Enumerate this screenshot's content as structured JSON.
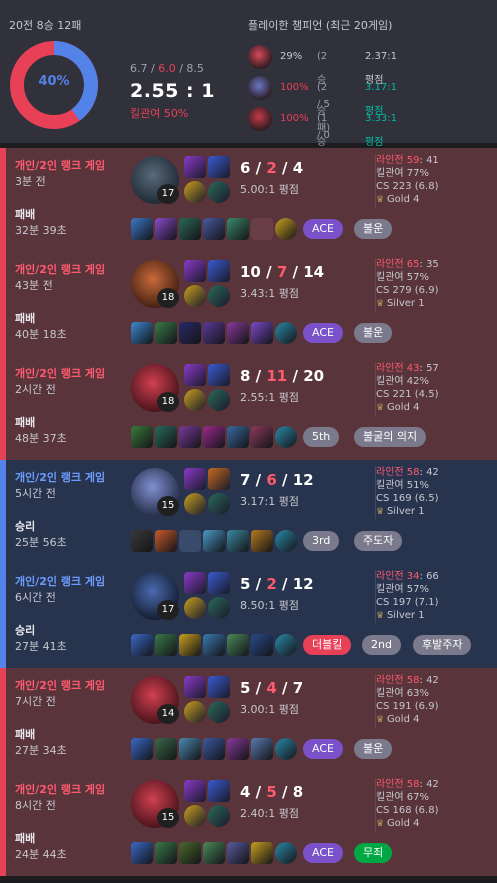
{
  "summary": {
    "record": "20전 8승 12패",
    "winrate_label": "40%",
    "winrate_fraction": 0.4,
    "kda_line": "6.7 / 6.0 / 8.5",
    "kda_k": "6.7",
    "kda_d": "6.0",
    "kda_a": "8.5",
    "ratio": "2.55 : 1",
    "kill_participation": "킬관여 50%",
    "colors": {
      "win": "#5383e8",
      "loss": "#e84057"
    }
  },
  "recent": {
    "heading": "플레이한 챔피언 (최근 20게임)",
    "champions": [
      {
        "icon": "champion-portrait-red",
        "winrate": "29%",
        "record": "(2승 / 5패)",
        "ratio": "2.37:1 평점"
      },
      {
        "icon": "champion-portrait-blue",
        "winrate": "100%",
        "record": "(2승 / 0패)",
        "ratio": "3.17:1 평점"
      },
      {
        "icon": "champion-portrait-red",
        "winrate": "100%",
        "record": "(1승 / 0패)",
        "ratio": "3.33:1 평점"
      }
    ]
  },
  "matches": [
    {
      "result": "loss",
      "mode": "개인/2인 랭크 게임",
      "ago": "3분 전",
      "result_label": "패배",
      "duration": "32분 39초",
      "level": "17",
      "k": "6",
      "d": "2",
      "a": "4",
      "ratio": "5.00:1 평점",
      "lane": "라인전 59",
      "lane_score": ": 41",
      "kp": "킬관여 77%",
      "cs": "CS 223 (6.8)",
      "tier": "Gold 4",
      "badges": [
        {
          "text": "ACE",
          "color": "#7b51c9"
        },
        {
          "text": "불운",
          "color": "#7a7a8c"
        }
      ]
    },
    {
      "result": "loss",
      "mode": "개인/2인 랭크 게임",
      "ago": "43분 전",
      "result_label": "패배",
      "duration": "40분 18초",
      "level": "18",
      "k": "10",
      "d": "7",
      "a": "14",
      "ratio": "3.43:1 평점",
      "lane": "라인전 65",
      "lane_score": ": 35",
      "kp": "킬관여 57%",
      "cs": "CS 279 (6.9)",
      "tier": "Silver 1",
      "badges": [
        {
          "text": "ACE",
          "color": "#7b51c9"
        },
        {
          "text": "불운",
          "color": "#7a7a8c"
        }
      ]
    },
    {
      "result": "loss",
      "mode": "개인/2인 랭크 게임",
      "ago": "2시간 전",
      "result_label": "패배",
      "duration": "48분 37초",
      "level": "18",
      "k": "8",
      "d": "11",
      "a": "20",
      "ratio": "2.55:1 평점",
      "lane": "라인전 43",
      "lane_score": ": 57",
      "kp": "킬관여 42%",
      "cs": "CS 221 (4.5)",
      "tier": "Gold 4",
      "badges": [
        {
          "text": "5th",
          "color": "#7a7a8c"
        },
        {
          "text": "불굴의 의지",
          "color": "#7a7a8c"
        }
      ]
    },
    {
      "result": "win",
      "mode": "개인/2인 랭크 게임",
      "ago": "5시간 전",
      "result_label": "승리",
      "duration": "25분 56초",
      "level": "15",
      "k": "7",
      "d": "6",
      "a": "12",
      "ratio": "3.17:1 평점",
      "lane": "라인전 58",
      "lane_score": ": 42",
      "kp": "킬관여 51%",
      "cs": "CS 169 (6.5)",
      "tier": "Silver 1",
      "badges": [
        {
          "text": "3rd",
          "color": "#7a7a8c"
        },
        {
          "text": "주도자",
          "color": "#7a7a8c"
        }
      ]
    },
    {
      "result": "win",
      "mode": "개인/2인 랭크 게임",
      "ago": "6시간 전",
      "result_label": "승리",
      "duration": "27분 41초",
      "level": "17",
      "k": "5",
      "d": "2",
      "a": "12",
      "ratio": "8.50:1 평점",
      "lane": "라인전 34",
      "lane_score": ": 66",
      "kp": "킬관여 57%",
      "cs": "CS 197 (7.1)",
      "tier": "Silver 1",
      "badges": [
        {
          "text": "더블킬",
          "color": "#e84057"
        },
        {
          "text": "2nd",
          "color": "#7a7a8c"
        },
        {
          "text": "후발주자",
          "color": "#7a7a8c"
        }
      ]
    },
    {
      "result": "loss",
      "mode": "개인/2인 랭크 게임",
      "ago": "7시간 전",
      "result_label": "패배",
      "duration": "27분 34초",
      "level": "14",
      "k": "5",
      "d": "4",
      "a": "7",
      "ratio": "3.00:1 평점",
      "lane": "라인전 58",
      "lane_score": ": 42",
      "kp": "킬관여 63%",
      "cs": "CS 191 (6.9)",
      "tier": "Gold 4",
      "badges": [
        {
          "text": "ACE",
          "color": "#7b51c9"
        },
        {
          "text": "불운",
          "color": "#7a7a8c"
        }
      ]
    },
    {
      "result": "loss",
      "mode": "개인/2인 랭크 게임",
      "ago": "8시간 전",
      "result_label": "패배",
      "duration": "24분 44초",
      "level": "15",
      "k": "4",
      "d": "5",
      "a": "8",
      "ratio": "2.40:1 평점",
      "lane": "라인전 58",
      "lane_score": ": 42",
      "kp": "킬관여 67%",
      "cs": "CS 168 (6.8)",
      "tier": "Gold 4",
      "badges": [
        {
          "text": "ACE",
          "color": "#7b51c9"
        },
        {
          "text": "무죄",
          "color": "#00a845"
        }
      ]
    }
  ]
}
